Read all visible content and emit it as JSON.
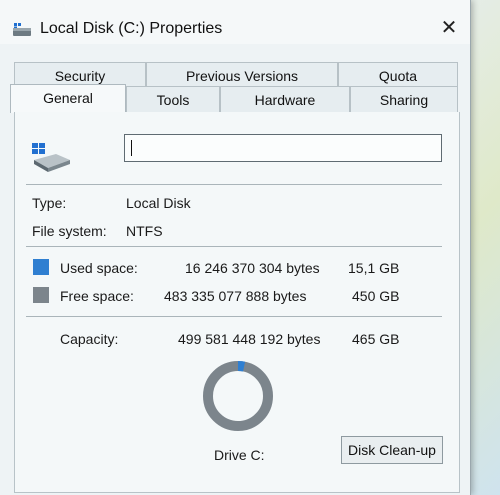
{
  "window": {
    "title": "Local Disk (C:) Properties",
    "close_glyph": "✕"
  },
  "tabs": [
    {
      "label": "Security"
    },
    {
      "label": "Previous Versions"
    },
    {
      "label": "Quota"
    },
    {
      "label": "General"
    },
    {
      "label": "Tools"
    },
    {
      "label": "Hardware"
    },
    {
      "label": "Sharing"
    }
  ],
  "active_tab": "General",
  "drive": {
    "name_value": "",
    "icon": "drive-icon"
  },
  "info": {
    "type_label": "Type:",
    "type_value": "Local Disk",
    "fs_label": "File system:",
    "fs_value": "NTFS"
  },
  "space": {
    "used": {
      "label": "Used space:",
      "bytes": "16 246 370 304 bytes",
      "size": "15,1 GB",
      "color": "#2f7fd1"
    },
    "free": {
      "label": "Free space:",
      "bytes": "483 335 077 888 bytes",
      "size": "450 GB",
      "color": "#7c858c"
    },
    "capacity": {
      "label": "Capacity:",
      "bytes": "499 581 448 192 bytes",
      "size": "465 GB"
    }
  },
  "chart_usage": {
    "used_fraction": 0.0325
  },
  "drive_label": "Drive C:",
  "cleanup_button": "Disk Clean-up"
}
